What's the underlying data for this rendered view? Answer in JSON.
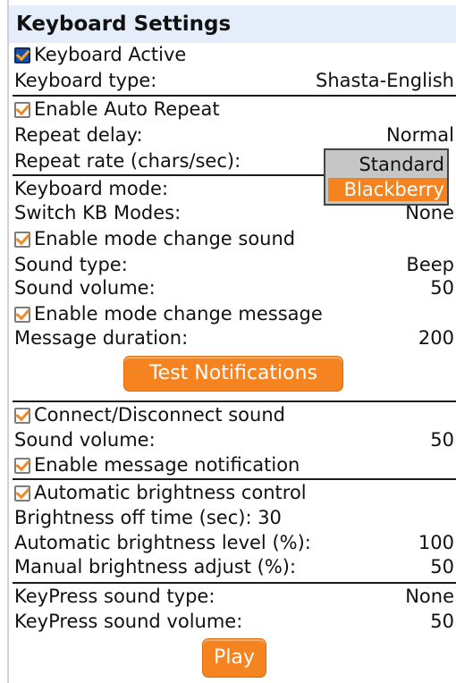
{
  "title": "Keyboard Settings",
  "settings": {
    "keyboard_active": "Keyboard Active",
    "keyboard_type": {
      "label": "Keyboard type:",
      "value": "Shasta-English"
    },
    "auto_repeat": "Enable Auto Repeat",
    "repeat_delay": {
      "label": "Repeat delay:",
      "value": "Normal"
    },
    "repeat_rate": {
      "label": "Repeat rate (chars/sec):"
    },
    "keyboard_mode": {
      "label": "Keyboard mode:"
    },
    "switch_modes": {
      "label": "Switch KB Modes:",
      "value": "None"
    },
    "mode_sound": "Enable mode change sound",
    "sound_type": {
      "label": "Sound type:",
      "value": "Beep"
    },
    "sound_volume": {
      "label": "Sound volume:",
      "value": "50"
    },
    "mode_message": "Enable mode change message",
    "message_duration": {
      "label": "Message duration:",
      "value": "200"
    },
    "test_button": "Test Notifications"
  },
  "connection": {
    "connect_sound": "Connect/Disconnect sound",
    "sound_volume": {
      "label": "Sound volume:",
      "value": "50"
    },
    "message_notification": "Enable message notification"
  },
  "brightness": {
    "auto_control": "Automatic brightness control",
    "off_time": "Brightness off time (sec): 30",
    "auto_level": {
      "label": "Automatic brightness level (%):",
      "value": "100"
    },
    "manual_adjust": {
      "label": "Manual brightness adjust (%):",
      "value": "50"
    }
  },
  "keypress": {
    "sound_type": {
      "label": "KeyPress sound type:",
      "value": "None"
    },
    "sound_volume": {
      "label": "KeyPress sound volume:",
      "value": "50"
    },
    "play_button": "Play"
  },
  "dropdown": {
    "options": [
      "Standard",
      "Blackberry"
    ],
    "selected": "Blackberry"
  },
  "colors": {
    "accent": "#f5831f",
    "header_bg": "#e4edf9",
    "focus_checkbox": "#1a4fa8"
  }
}
